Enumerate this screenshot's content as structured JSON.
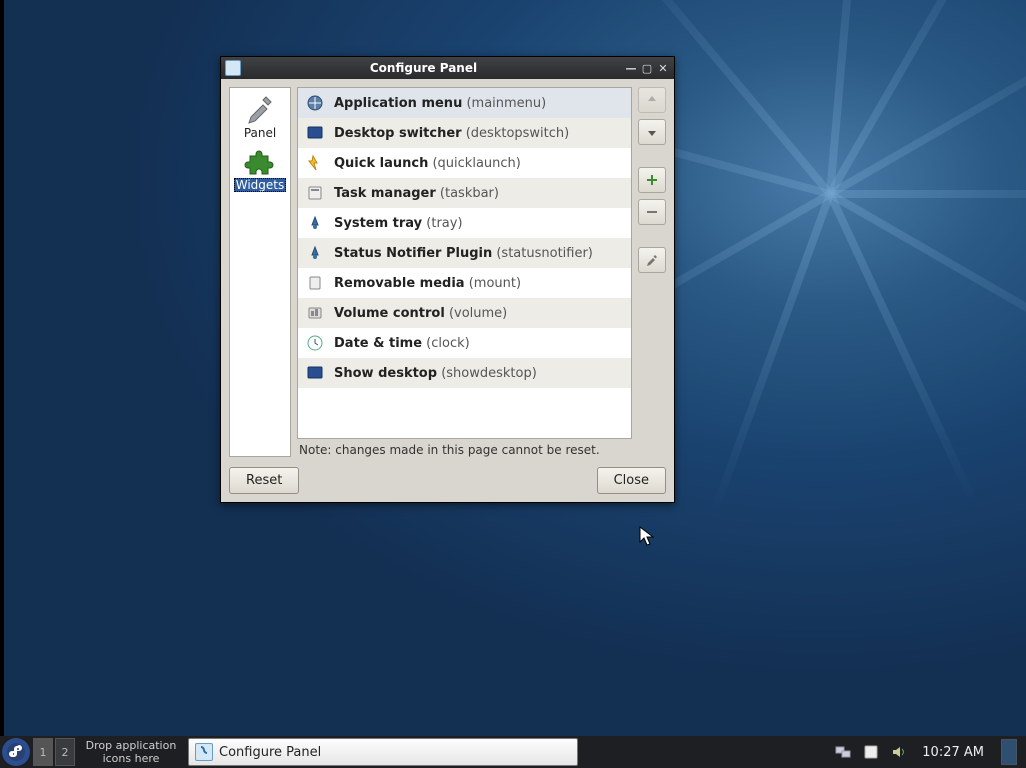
{
  "window": {
    "title": "Configure Panel",
    "sidebar": {
      "items": [
        {
          "label": "Panel"
        },
        {
          "label": "Widgets"
        }
      ],
      "selected_index": 1
    },
    "widgets": {
      "list": [
        {
          "name": "Application menu",
          "id": "(mainmenu)"
        },
        {
          "name": "Desktop switcher",
          "id": "(desktopswitch)"
        },
        {
          "name": "Quick launch",
          "id": "(quicklaunch)"
        },
        {
          "name": "Task manager",
          "id": "(taskbar)"
        },
        {
          "name": "System tray",
          "id": "(tray)"
        },
        {
          "name": "Status Notifier Plugin",
          "id": "(statusnotifier)"
        },
        {
          "name": "Removable media",
          "id": "(mount)"
        },
        {
          "name": "Volume control",
          "id": "(volume)"
        },
        {
          "name": "Date & time",
          "id": "(clock)"
        },
        {
          "name": "Show desktop",
          "id": "(showdesktop)"
        }
      ],
      "selected_index": 0,
      "note": "Note: changes made in this page cannot be reset."
    },
    "buttons": {
      "reset": "Reset",
      "close": "Close"
    }
  },
  "taskbar": {
    "workspaces": [
      "1",
      "2"
    ],
    "active_workspace": 0,
    "drop_hint": "Drop application icons here",
    "tasks": [
      {
        "title": "Configure Panel"
      }
    ],
    "clock": "10:27 AM"
  }
}
